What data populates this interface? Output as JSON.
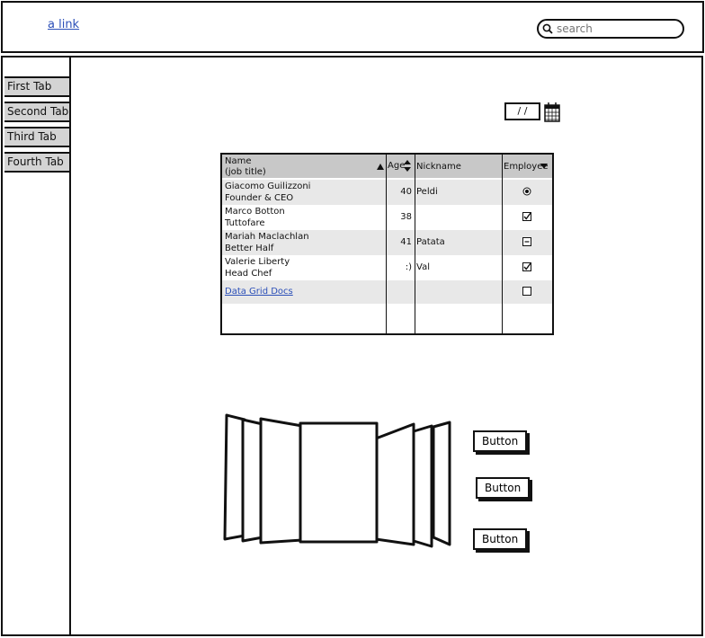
{
  "header": {
    "link": "a link",
    "search_placeholder": "search"
  },
  "tabs": [
    "First Tab",
    "Second Tab",
    "Third Tab",
    "Fourth Tab"
  ],
  "date": {
    "value": "/ /"
  },
  "grid": {
    "columns": {
      "name": "Name",
      "name_sub": "(job title)",
      "age": "Age",
      "nickname": "Nickname",
      "employee": "Employee"
    },
    "rows": [
      {
        "name": "Giacomo Guilizzoni",
        "title": "Founder & CEO",
        "age": "40",
        "nickname": "Peldi",
        "employee": "radio"
      },
      {
        "name": "Marco Botton",
        "title": "Tuttofare",
        "age": "38",
        "nickname": "",
        "employee": "checked"
      },
      {
        "name": "Mariah Maclachlan",
        "title": "Better Half",
        "age": "41",
        "nickname": "Patata",
        "employee": "indeterminate"
      },
      {
        "name": "Valerie Liberty",
        "title": "Head Chef",
        "age": ":)",
        "nickname": "Val",
        "employee": "checked"
      }
    ],
    "link_row": {
      "label": "Data Grid Docs",
      "employee": "unchecked"
    }
  },
  "buttons": [
    "Button",
    "Button",
    "Button"
  ]
}
